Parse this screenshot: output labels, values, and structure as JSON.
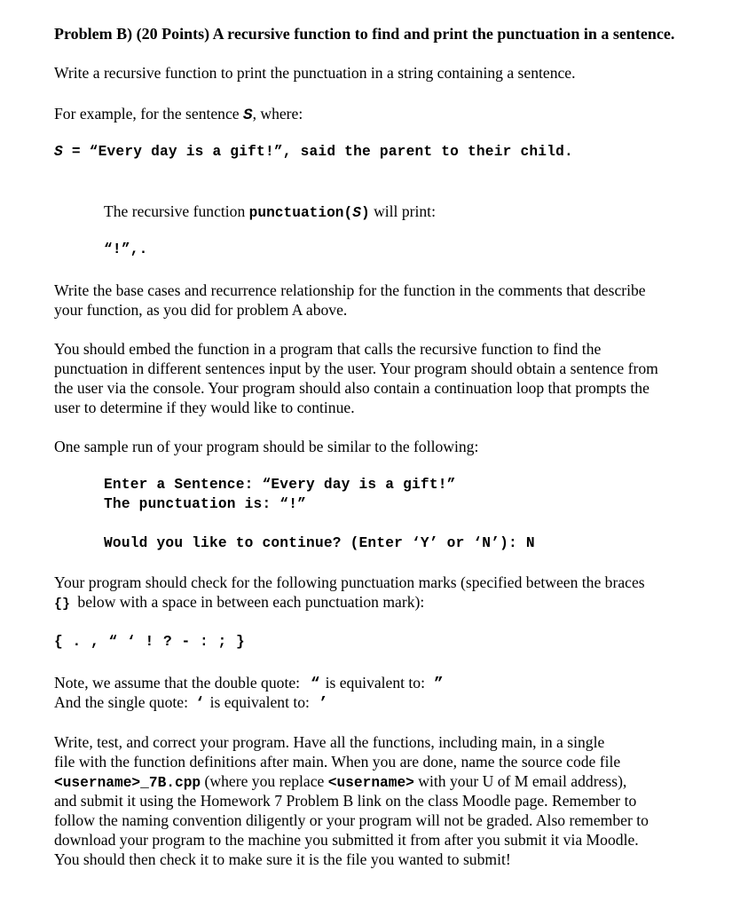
{
  "problem": {
    "title": "Problem B) (20 Points) A recursive function to find and print the punctuation in a sentence.",
    "intro": "Write a recursive function to print the punctuation in a string containing a sentence.",
    "example_lead_before": "For example, for the sentence ",
    "example_lead_var": "S",
    "example_lead_after": ", where:",
    "sentence_var": "S",
    "sentence_rest": " = “Every day is a gift!”, said the parent to their child.",
    "function_lead_before": "The recursive function ",
    "function_name": "punctuation(",
    "function_arg": "S",
    "function_close": ")",
    "function_lead_after": " will print:",
    "function_output": "“!”,.",
    "base_cases": [
      "Write the base cases and recurrence relationship for the function in the comments that describe",
      "your function, as you did for problem A above."
    ],
    "embed": [
      "You should embed the function in a program that calls the recursive function to find the",
      "punctuation in different sentences input by the user. Your program should obtain a sentence from",
      "the user via the console. Your program should also contain a continuation loop that prompts the",
      "user to determine if they would like to continue."
    ],
    "sample_run_lead": "One sample run of your program should be similar to the following:",
    "sample_run": {
      "line1": "Enter a Sentence: “Every day is a gift!”",
      "line2": "The punctuation is: “!”",
      "line3": "Would you like to continue? (Enter ‘Y’ or ‘N’): N"
    },
    "check_marks": [
      "Your program should check for the following punctuation marks (specified between the braces",
      " below with a space in between each punctuation mark):"
    ],
    "check_braces": "{}",
    "punctuation_set": [
      "{",
      ".",
      ",",
      "“",
      "‘",
      "!",
      "?",
      "-",
      ":",
      ";",
      "}"
    ],
    "note_double_before": "Note, we assume that the double quote:",
    "note_double_open": "“",
    "note_double_mid": "is equivalent to:",
    "note_double_close": "”",
    "note_single_before": "And the single quote:",
    "note_single_open": "‘",
    "note_single_mid": "is equivalent to:",
    "note_single_close": "’",
    "final": {
      "line1": "Write, test, and correct your program. Have all the functions, including main, in a single",
      "line2": "file with the function definitions after main. When you are done, name the source code file",
      "line3_code1": "<username>_7B.cpp",
      "line3_text1": " (where you replace ",
      "line3_code2": "<username>",
      "line3_text2": " with your U of M email address),",
      "line4": "and submit it using the Homework 7 Problem B link on the class Moodle page. Remember to",
      "line5": "follow the naming convention diligently or your program will not be graded.  Also remember to",
      "line6": "download your program to the machine you submitted it from after you submit it via Moodle.",
      "line7": "You should then check it to make sure it is the file you wanted to submit!"
    }
  }
}
